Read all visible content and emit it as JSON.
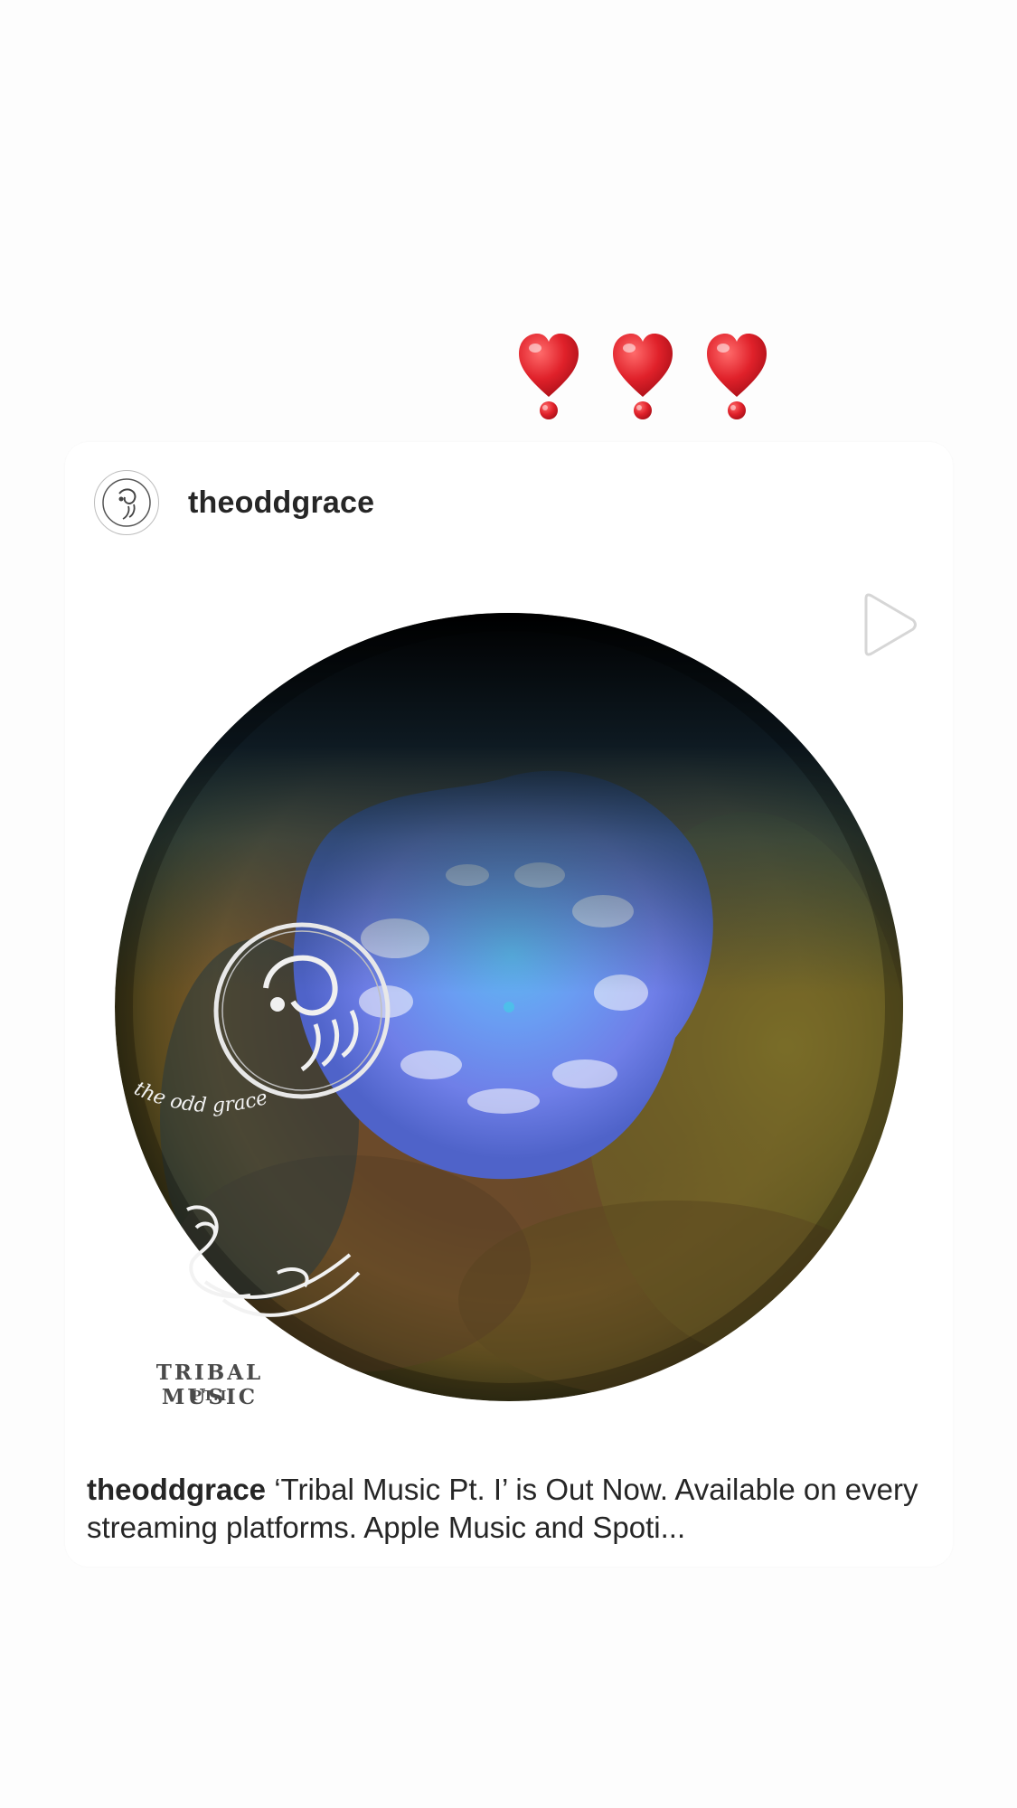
{
  "hearts": {
    "emoji": "❣",
    "count": 3,
    "color": "#e0212a"
  },
  "post": {
    "username": "theoddgrace",
    "avatar_icon": "the-odd-grace-logo-icon",
    "media_type_icon": "play-icon",
    "artwork": {
      "brand_text": "the odd grace",
      "album_title": "TRIBAL MUSIC",
      "album_part": "PT.I"
    },
    "caption": {
      "username": "theoddgrace",
      "text": "‘Tribal Music Pt. I’ is Out Now. Available on every streaming platforms. Apple Music and Spoti..."
    }
  },
  "colors": {
    "background": "#fdfdfd",
    "card": "#ffffff",
    "text": "#262626",
    "heart": "#e0212a"
  }
}
